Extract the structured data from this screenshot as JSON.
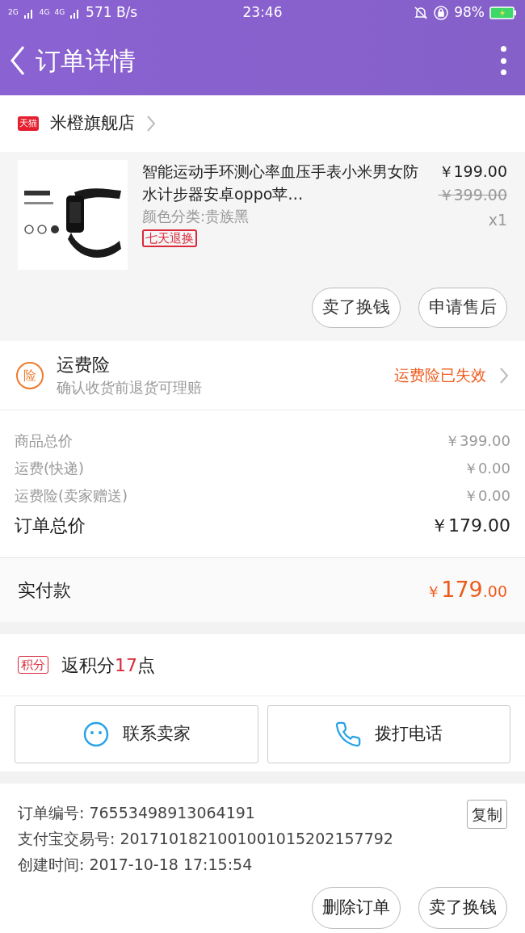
{
  "status_bar": {
    "signal_1": "2G",
    "signal_2": "4G",
    "signal_3": "4G",
    "speed": "571 B/s",
    "time": "23:46",
    "battery": "98%"
  },
  "header": {
    "title": "订单详情"
  },
  "store": {
    "badge": "天猫",
    "name": "米橙旗舰店"
  },
  "product": {
    "title": "智能运动手环测心率血压手表小米男女防水计步器安卓oppo苹…",
    "variant": "颜色分类:贵族黑",
    "tag": "七天退换",
    "price": "￥199.00",
    "original_price": "￥399.00",
    "quantity": "x1",
    "actions": [
      "卖了换钱",
      "申请售后"
    ]
  },
  "insurance": {
    "badge": "险",
    "title": "运费险",
    "subtitle": "确认收货前退货可理赔",
    "status": "运费险已失效"
  },
  "costs": [
    {
      "label": "商品总价",
      "value": "￥399.00"
    },
    {
      "label": "运费(快递)",
      "value": "￥0.00"
    },
    {
      "label": "运费险(卖家赠送)",
      "value": "￥0.00"
    }
  ],
  "total": {
    "label": "订单总价",
    "value": "￥179.00"
  },
  "paid": {
    "label": "实付款",
    "currency": "￥",
    "integer": "179",
    "decimal": ".00"
  },
  "points": {
    "badge": "积分",
    "prefix": "返积分",
    "amount": "17",
    "suffix": "点"
  },
  "contact_buttons": [
    {
      "kind": "chat",
      "label": "联系卖家"
    },
    {
      "kind": "phone",
      "label": "拨打电话"
    }
  ],
  "order_info": {
    "copy_button": "复制",
    "lines": [
      "订单编号: 76553498913064191",
      "支付宝交易号: 2017101821001001015202157792",
      "创建时间: 2017-10-18 17:15:54"
    ]
  },
  "bottom_actions": [
    "删除订单",
    "卖了换钱"
  ]
}
